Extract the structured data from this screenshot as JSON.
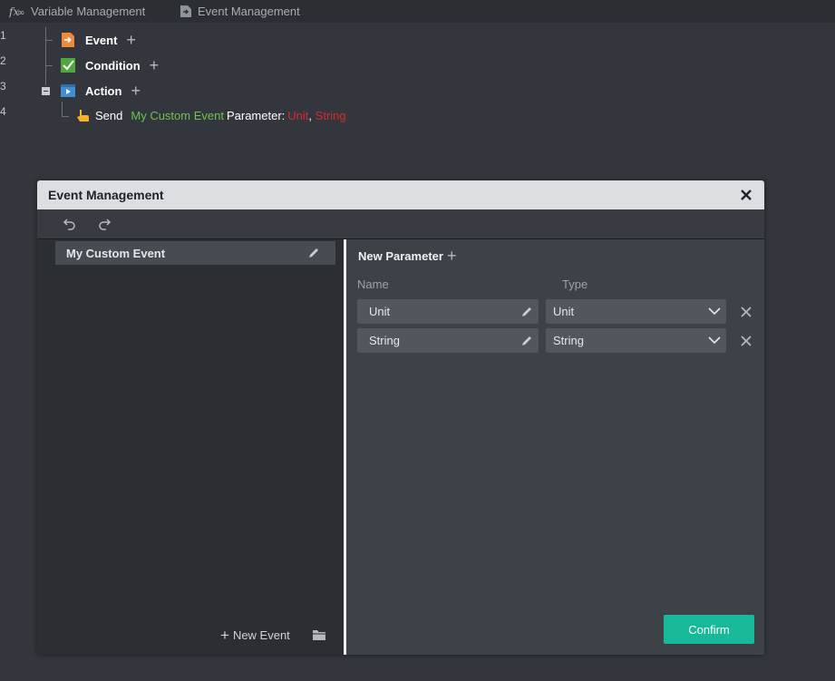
{
  "tabs": [
    {
      "label": "Variable Management",
      "icon": "function-icon"
    },
    {
      "label": "Event Management",
      "icon": "event-file-icon"
    }
  ],
  "line_numbers": [
    "1",
    "2",
    "3",
    "4"
  ],
  "tree": {
    "event_label": "Event",
    "condition_label": "Condition",
    "action_label": "Action",
    "send_row": {
      "verb": "Send",
      "event_name": "My Custom Event",
      "param_label": "Parameter:",
      "params": [
        "Unit",
        "String"
      ],
      "separator": ","
    }
  },
  "dialog": {
    "title": "Event Management",
    "events": [
      {
        "name": "My Custom Event"
      }
    ],
    "new_event_label": "New Event",
    "new_parameter_label": "New Parameter",
    "columns": {
      "name": "Name",
      "type": "Type"
    },
    "parameters": [
      {
        "name": "Unit",
        "type": "Unit"
      },
      {
        "name": "String",
        "type": "String"
      }
    ],
    "confirm_label": "Confirm"
  },
  "colors": {
    "accent": "#17b999",
    "event_name": "#6cc24a",
    "param_type": "#d9292b"
  }
}
